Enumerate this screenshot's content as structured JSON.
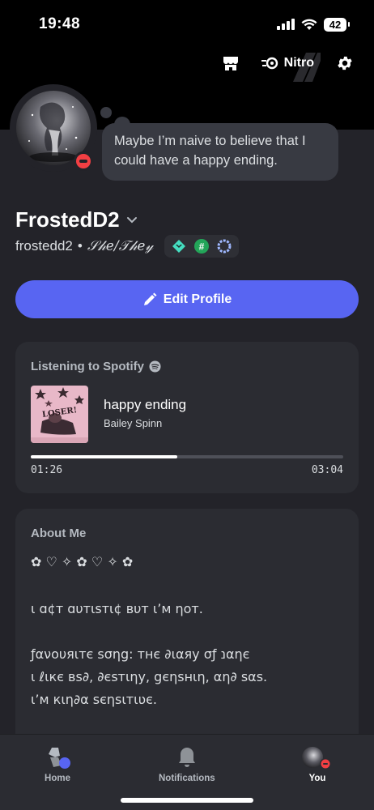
{
  "status_bar": {
    "time": "19:48",
    "battery": "42"
  },
  "top_actions": {
    "nitro_label": "Nitro"
  },
  "profile": {
    "custom_status": "Maybe I’m naive to believe that I could have a happy ending.",
    "display_name": "FrostedD2",
    "username": "frostedd2",
    "separator": "•",
    "pronouns": "𝒮𝒽𝑒/𝒯𝒽𝑒𝓎",
    "status": "dnd"
  },
  "edit_button": {
    "label": "Edit Profile"
  },
  "spotify": {
    "title": "Listening to Spotify",
    "track": "happy ending",
    "artist": "Bailey Spinn",
    "album_text": "LOSER!",
    "elapsed": "01:26",
    "duration": "03:04",
    "progress": 0.47
  },
  "about": {
    "title": "About Me",
    "lines": [
      "✿ ♡ ✧ ✿ ♡ ✧ ✿",
      "ɩ ɑ¢т ɑυтɩѕтɩ¢ вυт ɩ’м ηοт.",
      "ƒανουяιтє ѕσηg: тнє ∂ιαяу σƒ נαηє",
      "ι ℓιкє вѕ∂, ∂єѕтιηу, gєηѕнιη, αη∂ ѕαѕ.",
      "ι’м кιη∂α ѕєηѕιтιʋє."
    ]
  },
  "tabbar": {
    "home": "Home",
    "notifications": "Notifications",
    "you": "You"
  },
  "colors": {
    "accent": "#5865f2",
    "dnd": "#f23f43",
    "background": "#232329",
    "card": "#2b2c32"
  }
}
